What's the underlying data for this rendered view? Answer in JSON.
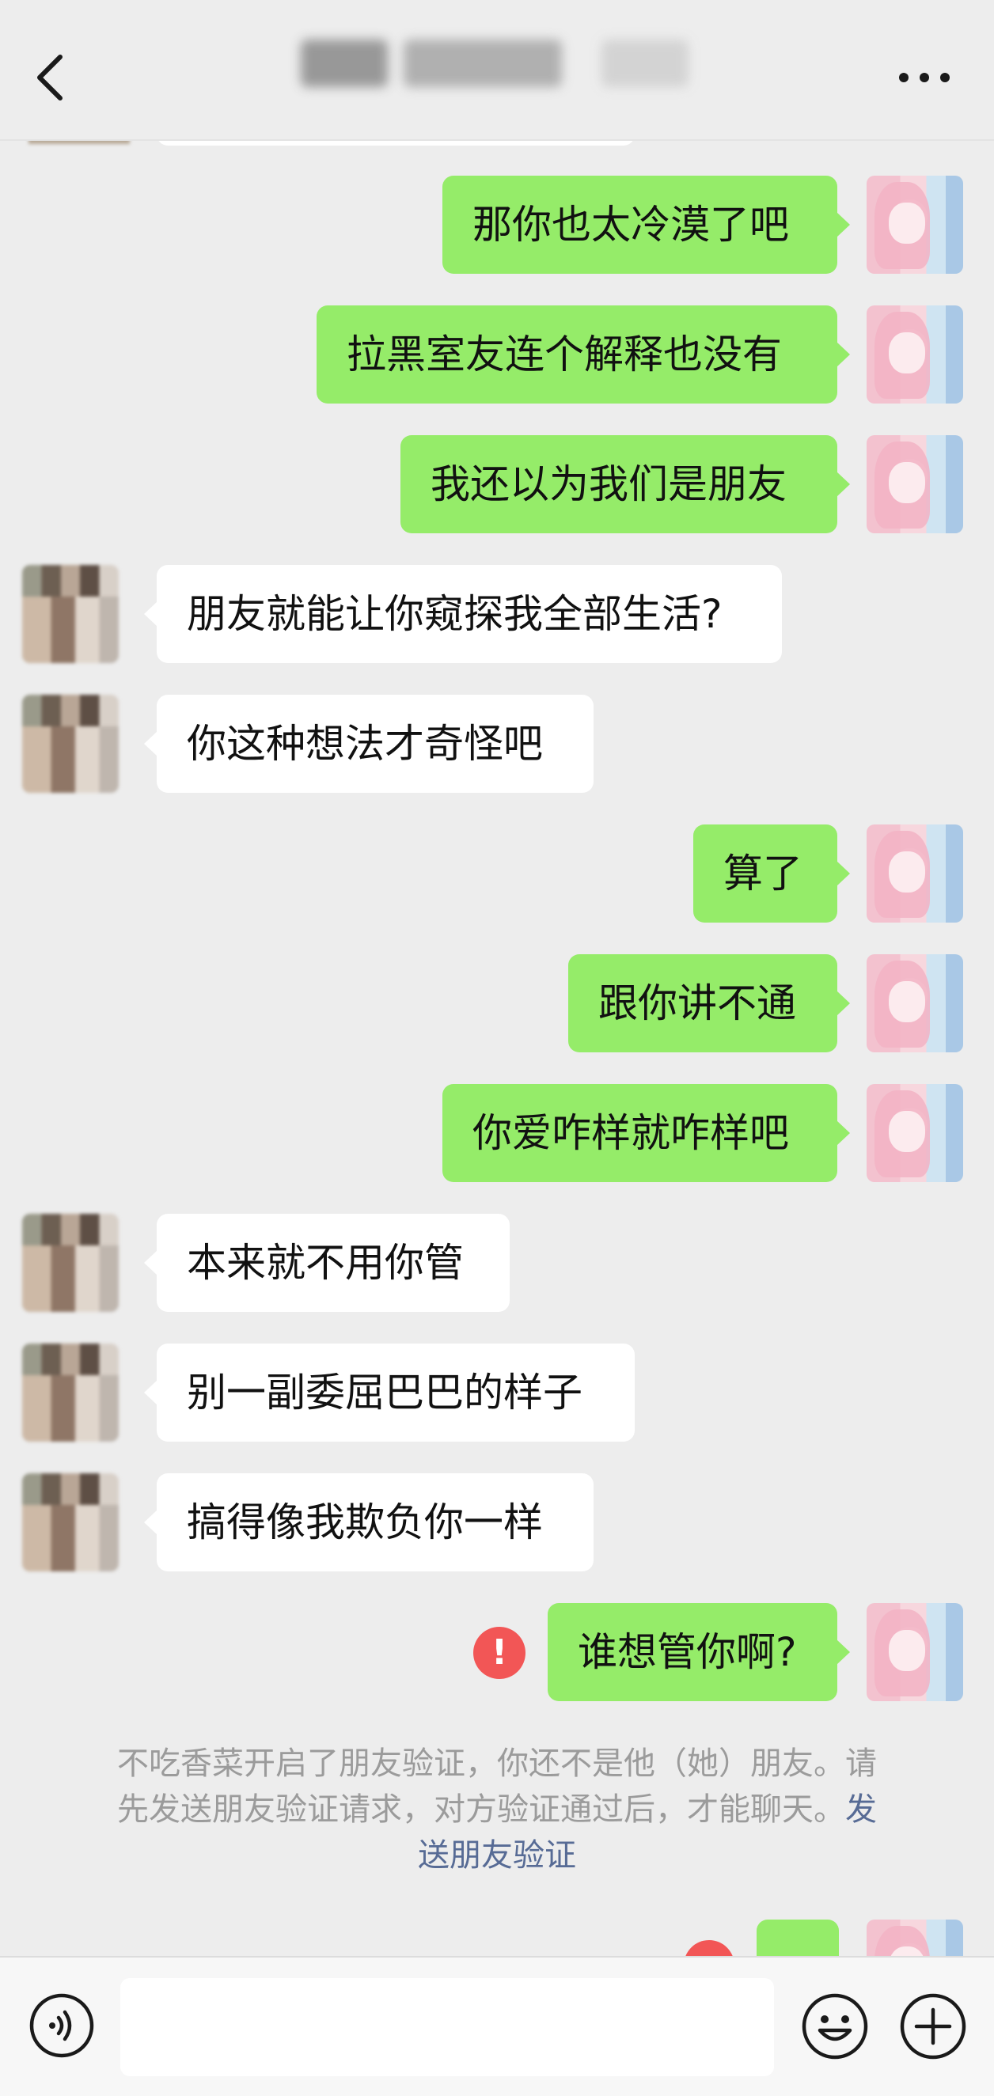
{
  "header": {
    "title": ""
  },
  "icons": {
    "back": "chevron-left-icon",
    "more": "more-dots-icon",
    "voice": "voice-icon",
    "emoji": "emoji-icon",
    "plus": "plus-icon",
    "fail": "exclamation-icon"
  },
  "colors": {
    "sent_bubble": "#95ec69",
    "received_bubble": "#ffffff",
    "background": "#ededed",
    "fail_badge": "#f25656",
    "link": "#576b95"
  },
  "messages": [
    {
      "side": "right",
      "text": "那你也太冷漠了吧"
    },
    {
      "side": "right",
      "text": "拉黑室友连个解释也没有"
    },
    {
      "side": "right",
      "text": "我还以为我们是朋友"
    },
    {
      "side": "left",
      "text": "朋友就能让你窥探我全部生活?"
    },
    {
      "side": "left",
      "text": "你这种想法才奇怪吧"
    },
    {
      "side": "right",
      "text": "算了"
    },
    {
      "side": "right",
      "text": "跟你讲不通"
    },
    {
      "side": "right",
      "text": "你爱咋样就咋样吧"
    },
    {
      "side": "left",
      "text": "本来就不用你管"
    },
    {
      "side": "left",
      "text": "别一副委屈巴巴的样子"
    },
    {
      "side": "left",
      "text": "搞得像我欺负你一样"
    },
    {
      "side": "right",
      "text": "谁想管你啊?",
      "failed": true,
      "fail_mark": "!"
    }
  ],
  "system_note": {
    "line1": "不吃香菜开启了朋友验证，你还不是他（她）朋友。请",
    "line2_text": "先发送朋友验证请求，对方验证通过后，才能聊天。",
    "line2_link": "发",
    "line3_link": "送朋友验证"
  },
  "input": {
    "value": ""
  }
}
